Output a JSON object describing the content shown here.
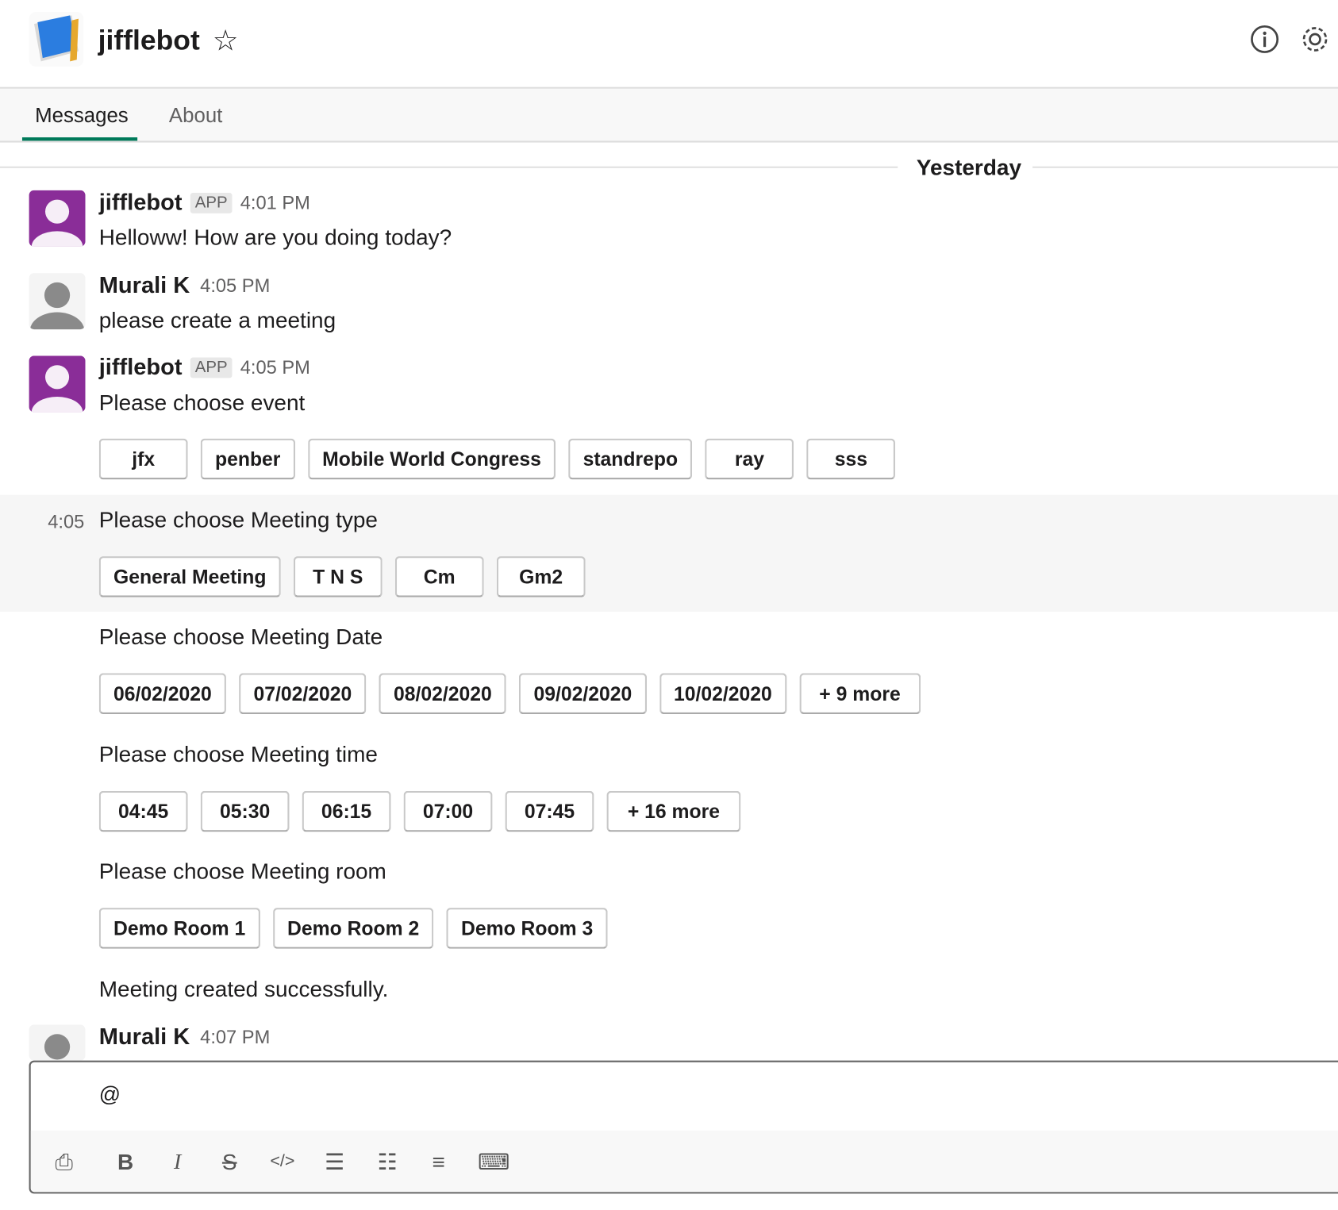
{
  "header": {
    "title": "jifflebot",
    "star_icon": "star-icon",
    "info_icon": "info-icon",
    "settings_icon": "gear-icon"
  },
  "tabs": [
    {
      "label": "Messages",
      "active": true
    },
    {
      "label": "About",
      "active": false
    }
  ],
  "day_divider": "Yesterday",
  "messages": [
    {
      "author": "jifflebot",
      "badge": "APP",
      "time": "4:01 PM",
      "text": "Helloww! How are you doing today?"
    },
    {
      "author": "Murali K",
      "time": "4:05 PM",
      "text": "please create a meeting"
    },
    {
      "author": "jifflebot",
      "badge": "APP",
      "time": "4:05 PM",
      "text": "Please choose event",
      "buttons": [
        "jfx",
        "penber",
        "Mobile World Congress",
        "standrepo",
        "ray",
        "sss"
      ]
    },
    {
      "hover_time": "4:05",
      "text": "Please choose Meeting type",
      "buttons": [
        "General Meeting",
        "T N S",
        "Cm",
        "Gm2"
      ]
    },
    {
      "text": "Please choose Meeting Date",
      "buttons": [
        "06/02/2020",
        "07/02/2020",
        "08/02/2020",
        "09/02/2020",
        "10/02/2020",
        "+ 9 more"
      ]
    },
    {
      "text": "Please choose Meeting time",
      "buttons": [
        "04:45",
        "05:30",
        "06:15",
        "07:00",
        "07:45",
        "+ 16 more"
      ]
    },
    {
      "text": "Please choose Meeting room",
      "buttons": [
        "Demo Room 1",
        "Demo Room 2",
        "Demo Room 3"
      ]
    },
    {
      "text": "Meeting created successfully."
    },
    {
      "author": "Murali K",
      "time": "4:07 PM"
    }
  ],
  "composer": {
    "value": "@",
    "tools": [
      "attach-icon",
      "bold-icon",
      "italic-icon",
      "strikethrough-icon",
      "code-icon",
      "ordered-list-icon",
      "bulleted-list-icon",
      "blockquote-icon",
      "code-block-icon"
    ]
  },
  "colors": {
    "accent": "#007a5a",
    "bot_avatar": "#8a2d98"
  }
}
